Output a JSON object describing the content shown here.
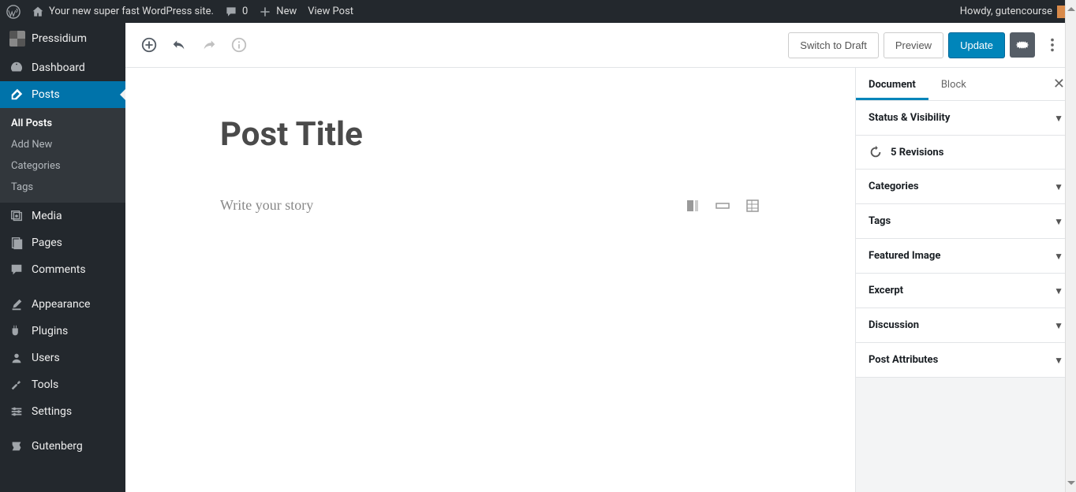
{
  "adminbar": {
    "site_title": "Your new super fast WordPress site.",
    "comments_count": "0",
    "new_label": "New",
    "view_post": "View Post",
    "howdy": "Howdy, gutencourse"
  },
  "sidebar": {
    "brand": "Pressidium",
    "items": [
      {
        "id": "dashboard",
        "label": "Dashboard"
      },
      {
        "id": "posts",
        "label": "Posts"
      },
      {
        "id": "media",
        "label": "Media"
      },
      {
        "id": "pages",
        "label": "Pages"
      },
      {
        "id": "comments",
        "label": "Comments"
      },
      {
        "id": "appearance",
        "label": "Appearance"
      },
      {
        "id": "plugins",
        "label": "Plugins"
      },
      {
        "id": "users",
        "label": "Users"
      },
      {
        "id": "tools",
        "label": "Tools"
      },
      {
        "id": "settings",
        "label": "Settings"
      },
      {
        "id": "gutenberg",
        "label": "Gutenberg"
      }
    ],
    "posts_submenu": [
      {
        "id": "all-posts",
        "label": "All Posts"
      },
      {
        "id": "add-new",
        "label": "Add New"
      },
      {
        "id": "categories",
        "label": "Categories"
      },
      {
        "id": "tags",
        "label": "Tags"
      }
    ]
  },
  "toolbar": {
    "switch_draft": "Switch to Draft",
    "preview": "Preview",
    "update": "Update"
  },
  "editor": {
    "post_title": "Post Title",
    "placeholder": "Write your story"
  },
  "settings": {
    "tabs": {
      "document": "Document",
      "block": "Block"
    },
    "panels": {
      "status": "Status & Visibility",
      "revisions": "5 Revisions",
      "categories": "Categories",
      "tags": "Tags",
      "featured": "Featured Image",
      "excerpt": "Excerpt",
      "discussion": "Discussion",
      "attributes": "Post Attributes"
    }
  }
}
